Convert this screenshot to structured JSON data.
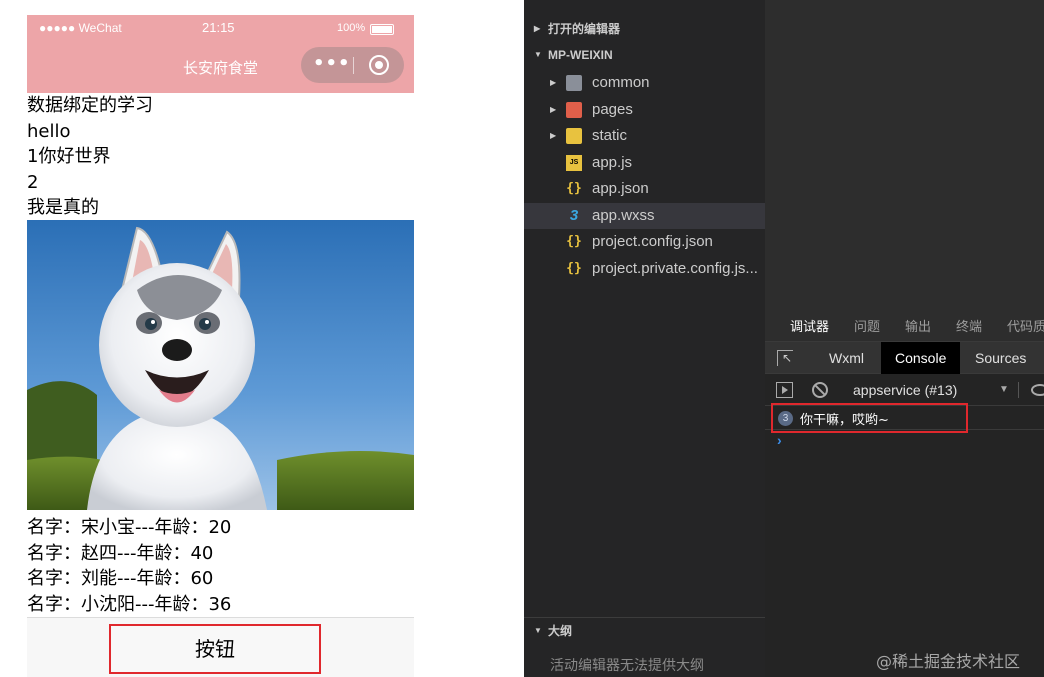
{
  "phone": {
    "status_bar": {
      "carrier": "●●●●● WeChat",
      "time": "21:15",
      "battery": "100%"
    },
    "nav_title": "长安府食堂",
    "capsule": {
      "more": "•••"
    },
    "lines": [
      "数据绑定的学习",
      "hello",
      "1你好世界",
      "2",
      "我是真的"
    ],
    "image": {
      "alt": "husky-puppy"
    },
    "people": [
      "名字：宋小宝---年龄：20",
      "名字：赵四---年龄：40",
      "名字：刘能---年龄：60",
      "名字：小沈阳---年龄：36"
    ],
    "button_label": "按钮",
    "colors": {
      "nav": "#eda5a8",
      "highlight": "#e0282d"
    }
  },
  "explorer": {
    "open_editors": "打开的编辑器",
    "project": "MP-WEIXIN",
    "files": [
      {
        "name": "common",
        "icon": "folder-icon"
      },
      {
        "name": "pages",
        "icon": "folder-icon"
      },
      {
        "name": "static",
        "icon": "folder-icon"
      },
      {
        "name": "app.js",
        "icon": "js-file-icon"
      },
      {
        "name": "app.json",
        "icon": "json-file-icon"
      },
      {
        "name": "app.wxss",
        "icon": "css-file-icon"
      },
      {
        "name": "project.config.json",
        "icon": "json-file-icon"
      },
      {
        "name": "project.private.config.js...",
        "icon": "json-file-icon"
      }
    ],
    "outline_title": "大纲",
    "outline_message": "活动编辑器无法提供大纲"
  },
  "devtools": {
    "top_tabs": [
      "调试器",
      "问题",
      "输出",
      "终端",
      "代码质"
    ],
    "panel_tabs": [
      "Wxml",
      "Console",
      "Sources"
    ],
    "context": "appservice (#13)",
    "console": {
      "count": "3",
      "message": "你干嘛，哎哟~",
      "prompt": "›"
    }
  },
  "watermark": "@稀土掘金技术社区"
}
